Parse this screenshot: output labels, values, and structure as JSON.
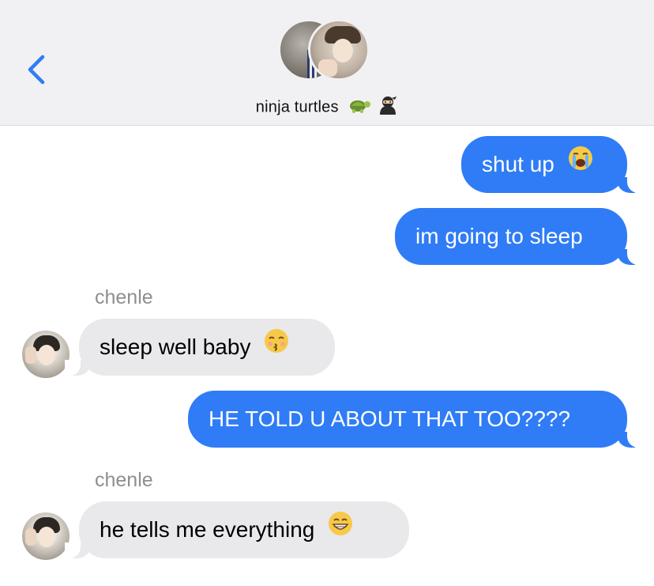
{
  "header": {
    "back_icon": "chevron-left-icon",
    "group_name": "ninja turtles",
    "title_emojis": [
      "turtle-icon",
      "ninja-icon"
    ],
    "accent_color": "#2f7cf6"
  },
  "messages": [
    {
      "direction": "outgoing",
      "text": "shut up",
      "emoji": "loudly-crying-face-icon"
    },
    {
      "direction": "outgoing",
      "text": "im going to sleep",
      "emoji": ""
    },
    {
      "direction": "incoming",
      "sender": "chenle",
      "text": "sleep well baby",
      "emoji": "kissing-face-closed-eyes-icon"
    },
    {
      "direction": "outgoing",
      "text": "HE TOLD U ABOUT THAT TOO????",
      "emoji": ""
    },
    {
      "direction": "incoming",
      "sender": "chenle",
      "text": "he tells me everything",
      "emoji": "grinning-face-icon"
    }
  ],
  "colors": {
    "outgoing_bubble": "#2f7cf6",
    "incoming_bubble": "#e9e9eb",
    "sender_label": "#8e8e93"
  }
}
